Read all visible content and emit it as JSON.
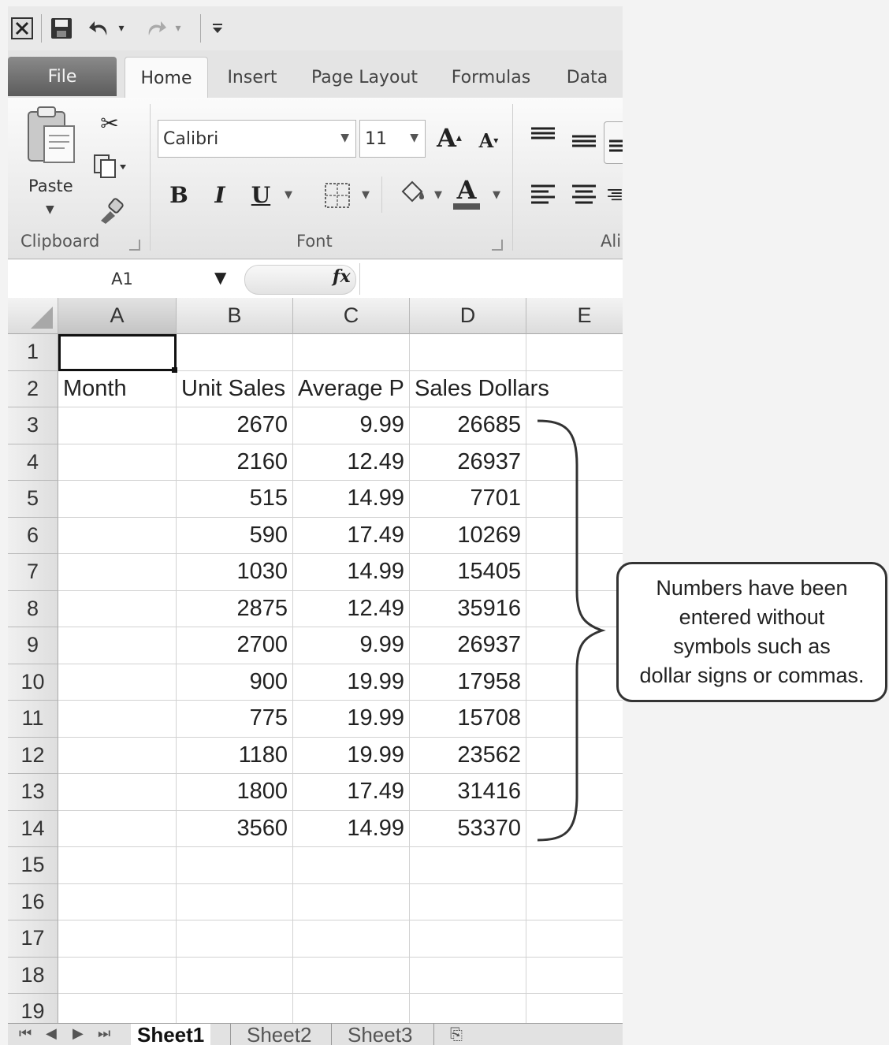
{
  "ribbon": {
    "tabs": [
      "File",
      "Home",
      "Insert",
      "Page Layout",
      "Formulas",
      "Data"
    ],
    "active_tab": "Home",
    "clipboard": {
      "paste_label": "Paste",
      "group_label": "Clipboard"
    },
    "font": {
      "name": "Calibri",
      "size": "11",
      "group_label": "Font",
      "bold": "B",
      "italic": "I",
      "underline": "U"
    },
    "alignment": {
      "group_label_partial": "Ali"
    }
  },
  "formula_bar": {
    "name_box": "A1",
    "fx": "fx",
    "formula": ""
  },
  "sheet": {
    "columns": [
      "A",
      "B",
      "C",
      "D",
      "E"
    ],
    "rows": [
      "1",
      "2",
      "3",
      "4",
      "5",
      "6",
      "7",
      "8",
      "9",
      "10",
      "11",
      "12",
      "13",
      "14",
      "15",
      "16",
      "17",
      "18",
      "19"
    ],
    "headers": {
      "A": "Month",
      "B": "Unit Sales",
      "C": "Average P",
      "D": "Sales Dollars"
    },
    "data": [
      {
        "b": "2670",
        "c": "9.99",
        "d": "26685"
      },
      {
        "b": "2160",
        "c": "12.49",
        "d": "26937"
      },
      {
        "b": "515",
        "c": "14.99",
        "d": "7701"
      },
      {
        "b": "590",
        "c": "17.49",
        "d": "10269"
      },
      {
        "b": "1030",
        "c": "14.99",
        "d": "15405"
      },
      {
        "b": "2875",
        "c": "12.49",
        "d": "35916"
      },
      {
        "b": "2700",
        "c": "9.99",
        "d": "26937"
      },
      {
        "b": "900",
        "c": "19.99",
        "d": "17958"
      },
      {
        "b": "775",
        "c": "19.99",
        "d": "15708"
      },
      {
        "b": "1180",
        "c": "19.99",
        "d": "23562"
      },
      {
        "b": "1800",
        "c": "17.49",
        "d": "31416"
      },
      {
        "b": "3560",
        "c": "14.99",
        "d": "53370"
      }
    ],
    "sheet_tabs": [
      "Sheet1",
      "Sheet2",
      "Sheet3"
    ],
    "active_sheet": "Sheet1"
  },
  "callout": {
    "text": "Numbers have been\nentered without\nsymbols such as\ndollar signs or commas."
  },
  "icons": [
    "excel-icon",
    "save-icon",
    "undo-icon",
    "redo-icon",
    "customize-icon",
    "paste-icon",
    "cut-icon",
    "copy-icon",
    "format-painter-icon",
    "grow-font-icon",
    "shrink-font-icon",
    "borders-icon",
    "fill-color-icon",
    "font-color-icon",
    "align-top-icon",
    "align-middle-icon",
    "align-left-icon",
    "align-center-icon",
    "fx-icon",
    "sheet-nav-icons",
    "insert-sheet-icon"
  ]
}
